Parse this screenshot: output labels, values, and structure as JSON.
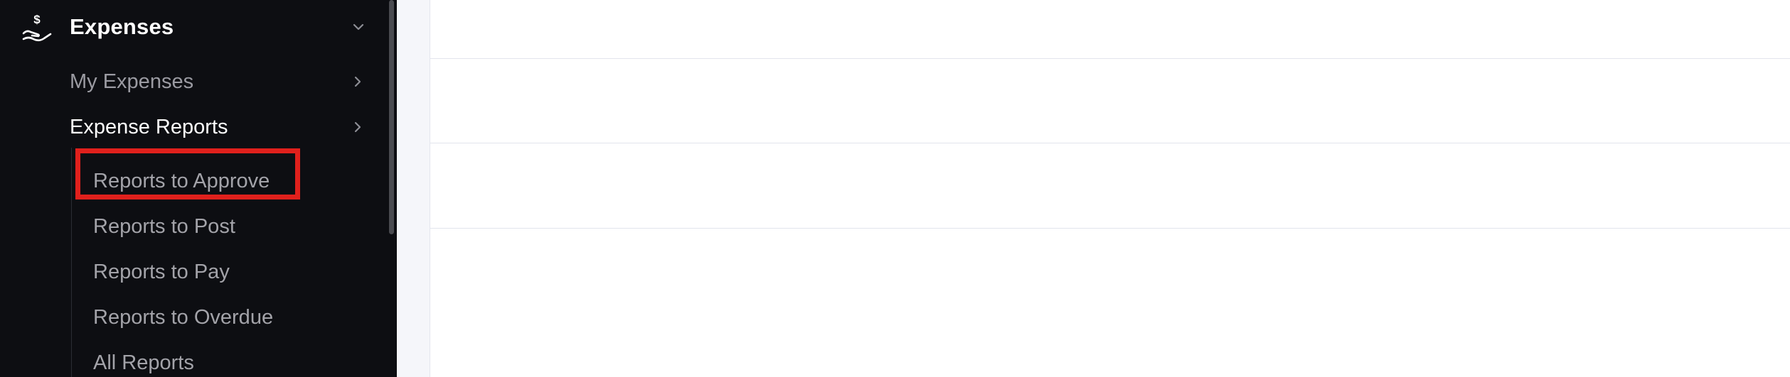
{
  "sidebar": {
    "section": {
      "title": "Expenses",
      "icon": "hand-dollar-icon",
      "expanded": true
    },
    "items": [
      {
        "label": "My Expenses",
        "state": "collapsed"
      },
      {
        "label": "Expense Reports",
        "state": "active"
      }
    ],
    "sub_items": [
      {
        "label": "Reports to Approve",
        "highlighted": true
      },
      {
        "label": "Reports to Post"
      },
      {
        "label": "Reports to Pay"
      },
      {
        "label": "Reports to Overdue"
      },
      {
        "label": "All Reports"
      }
    ]
  },
  "colors": {
    "sidebar_bg": "#0d0e12",
    "active_text": "#ffffff",
    "inactive_text": "#9b9ba2",
    "highlight_border": "#e0201c",
    "content_bg": "#ffffff",
    "gutter_bg": "#f5f6fa"
  }
}
